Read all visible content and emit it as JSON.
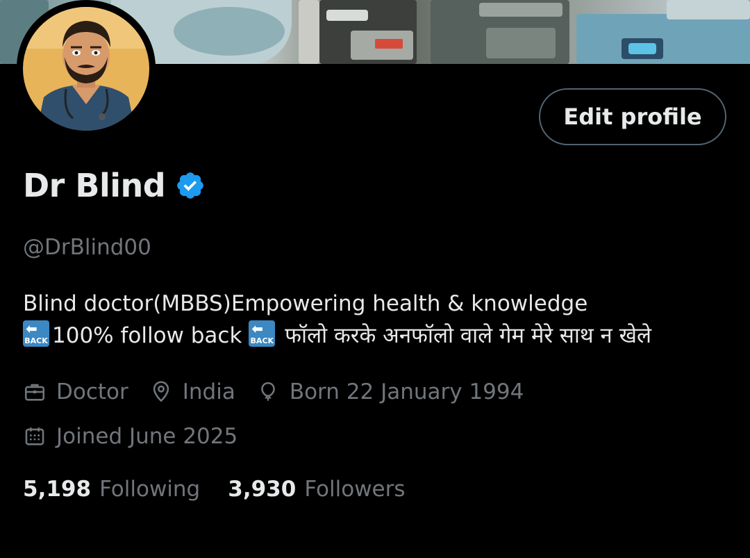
{
  "profile": {
    "display_name": "Dr Blind",
    "handle": "@DrBlind00",
    "edit_label": "Edit profile",
    "bio_line1": "Blind doctor(MBBS)Empowering health & knowledge",
    "bio_line2_a": "100% follow back",
    "bio_line2_b": "फॉलो करके अनफॉलो वाले गेम मेरे साथ न खेले",
    "back_emoji_text": "BACK",
    "profession": "Doctor",
    "location": "India",
    "birthday": "Born 22 January 1994",
    "joined": "Joined June 2025",
    "following_count": "5,198",
    "following_label": "Following",
    "followers_count": "3,930",
    "followers_label": "Followers"
  },
  "icons": {
    "verified": "verified-badge-icon",
    "profession": "briefcase-icon",
    "location": "location-pin-icon",
    "birthday": "balloon-icon",
    "joined": "calendar-icon"
  },
  "colors": {
    "background": "#000000",
    "primary_text": "#e7e9ea",
    "secondary_text": "#71767b",
    "verified_blue": "#1d9bf0",
    "button_border": "#536471"
  }
}
